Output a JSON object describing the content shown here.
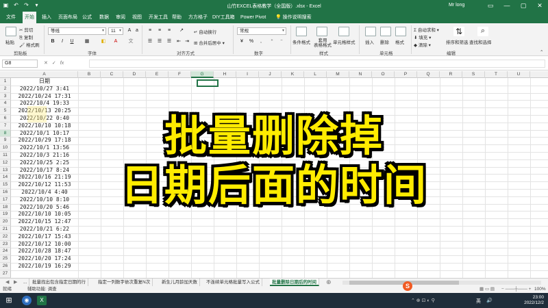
{
  "window": {
    "title": "山竹EXCEL表格教学（全国版）.xlsx - Excel",
    "user": "Mr long"
  },
  "tabs": [
    "文件",
    "开始",
    "插入",
    "页面布局",
    "公式",
    "数据",
    "审阅",
    "视图",
    "开发工具",
    "帮助",
    "方方格子",
    "DIY工具箱",
    "Power Pivot"
  ],
  "tab_search": "操作说明搜索",
  "ribbon": {
    "clipboard": {
      "paste": "粘贴",
      "cut": "剪切",
      "copy": "复制",
      "painter": "格式刷",
      "label": "剪贴板"
    },
    "font": {
      "name": "等线",
      "size": "11",
      "label": "字体",
      "bold": "B",
      "italic": "I",
      "underline": "U"
    },
    "alignment": {
      "wrap": "自动换行",
      "merge": "合并后居中",
      "label": "对齐方式"
    },
    "number": {
      "format": "常规",
      "label": "数字"
    },
    "styles": {
      "cond": "条件格式",
      "table": "套用\n表格格式",
      "cell": "单元格样式",
      "label": "样式"
    },
    "cells": {
      "insert": "插入",
      "delete": "删除",
      "format": "格式",
      "label": "单元格"
    },
    "editing": {
      "autosum": "自动求和",
      "fill": "填充",
      "clear": "清除",
      "sort": "排序和筛选",
      "find": "查找和选择",
      "label": "编辑"
    }
  },
  "formula_bar": {
    "name_box": "G8",
    "fx": "fx",
    "value": ""
  },
  "columns": [
    "A",
    "B",
    "C",
    "D",
    "E",
    "F",
    "G",
    "H",
    "I",
    "J",
    "K",
    "L",
    "M",
    "N",
    "O",
    "P",
    "Q",
    "R",
    "S",
    "T",
    "U"
  ],
  "selected_column": "G",
  "selected_row": 8,
  "rows": [
    "1",
    "2",
    "3",
    "4",
    "5",
    "6",
    "7",
    "8",
    "9",
    "10",
    "11",
    "12",
    "13",
    "14",
    "15",
    "16",
    "17",
    "18",
    "19",
    "20",
    "21",
    "22",
    "23",
    "24",
    "25",
    "26",
    "27"
  ],
  "column_a": [
    "日期",
    "2022/10/27 3:41",
    "2022/10/24 17:31",
    "2022/10/4 19:33",
    "2022/10/13 20:25",
    "2022/10/22 0:40",
    "2022/10/10 10:18",
    "2022/10/1 10:17",
    "2022/10/29 17:18",
    "2022/10/1 13:56",
    "2022/10/3 21:16",
    "2022/10/25 2:25",
    "2022/10/17 8:24",
    "2022/10/16 21:19",
    "2022/10/12 11:53",
    "2022/10/4 4:40",
    "2022/10/10 8:10",
    "2022/10/20 5:46",
    "2022/10/10 10:05",
    "2022/10/15 12:47",
    "2022/10/21 6:22",
    "2022/10/17 15:43",
    "2022/10/12 10:00",
    "2022/10/28 18:47",
    "2022/10/20 17:24",
    "2022/10/19 16:29"
  ],
  "overlay": {
    "line1": "批量删除掉",
    "line2": "日期后面的时间"
  },
  "sheet_tabs": [
    "...",
    "批量找出包含指定日期的行",
    "指定一列数字依次重复N次",
    "新生儿月龄加天数",
    "不连续单元格批量写入公式",
    "批量删除日期后的时间"
  ],
  "status": {
    "ready": "就绪",
    "accessibility": "辅助功能: 调查",
    "zoom": "100%"
  },
  "taskbar": {
    "time": "23:00",
    "date": "2022/12/2",
    "ime": "英"
  }
}
